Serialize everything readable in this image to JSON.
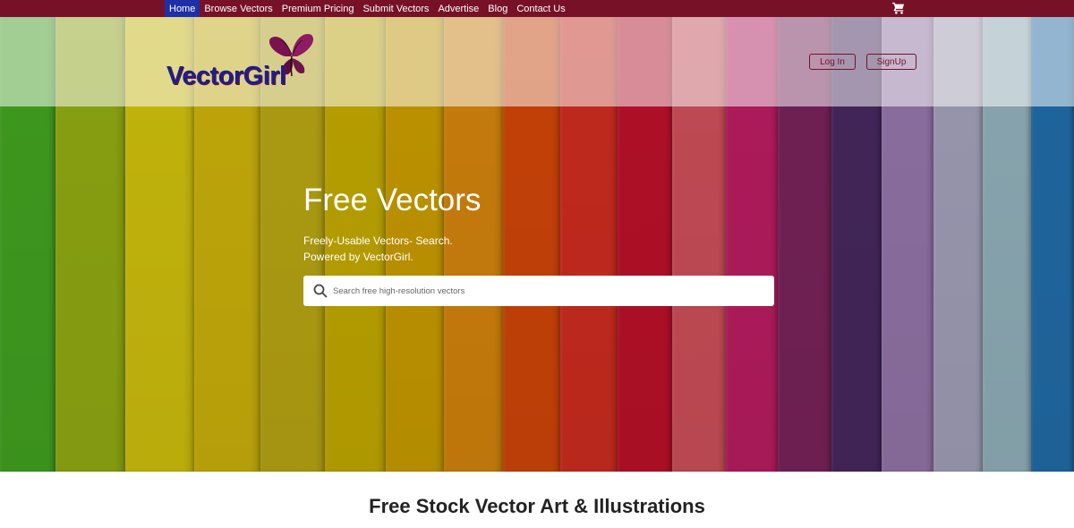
{
  "nav": {
    "items": [
      {
        "label": "Home",
        "active": true
      },
      {
        "label": "Browse Vectors",
        "active": false
      },
      {
        "label": "Premium Pricing",
        "active": false
      },
      {
        "label": "Submit Vectors",
        "active": false
      },
      {
        "label": "Advertise",
        "active": false
      },
      {
        "label": "Blog",
        "active": false
      },
      {
        "label": "Contact Us",
        "active": false
      }
    ],
    "cart_icon": "shopping-cart-icon"
  },
  "header": {
    "logo_text": "VectorGirl",
    "logo_icon": "butterfly-icon",
    "login_label": "Log In",
    "signup_label": "SignUp"
  },
  "hero": {
    "title": "Free Vectors",
    "subtitle_line1": "Freely-Usable Vectors- Search.",
    "subtitle_line2": "Powered by VectorGirl.",
    "search_placeholder": "Search free high-resolution vectors",
    "search_value": ""
  },
  "main": {
    "section_title": "Free Stock Vector Art & Illustrations"
  },
  "colors": {
    "nav_background": "#761128",
    "nav_active": "#1e2fa8",
    "logo_text": "#1c1f8a",
    "button_border": "#761128",
    "stripes": [
      "#3f9a1f",
      "#8aa212",
      "#c5b60c",
      "#c1a80a",
      "#ae9d12",
      "#b9a100",
      "#bf9400",
      "#c97d0c",
      "#c64208",
      "#c42a1e",
      "#b21027",
      "#c24b55",
      "#b01b5c",
      "#722155",
      "#43265a",
      "#8c6fa0",
      "#9a98b0",
      "#8aa7b1",
      "#1f67a0"
    ]
  }
}
